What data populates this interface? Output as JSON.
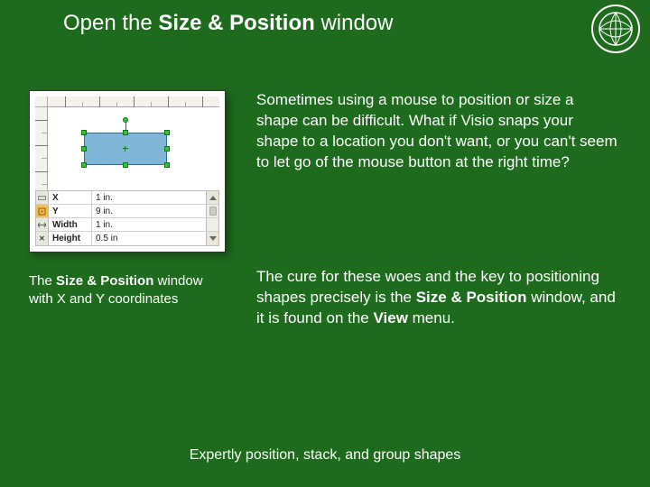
{
  "title": {
    "pre": "Open the ",
    "bold": "Size & Position",
    "post": " window"
  },
  "caption": {
    "pre": "The ",
    "bold": "Size & Position",
    "post": " window with X and Y coordinates"
  },
  "para1": "Sometimes using a mouse to position or size a shape can be difficult. What if Visio snaps your shape to a location you don't want, or you can't seem to let go of the mouse button at the right time?",
  "para2": {
    "seg1": "The cure for these woes and the key to positioning shapes precisely is the ",
    "bold1": "Size & Position",
    "seg2": " window, and it is found on the ",
    "bold2": "View",
    "seg3": " menu."
  },
  "footer": "Expertly position, stack, and group shapes",
  "sp": {
    "rows": [
      {
        "label": "X",
        "value": "1 in."
      },
      {
        "label": "Y",
        "value": "9 in."
      },
      {
        "label": "Width",
        "value": "1 in."
      },
      {
        "label": "Height",
        "value": "0.5 in"
      }
    ]
  }
}
